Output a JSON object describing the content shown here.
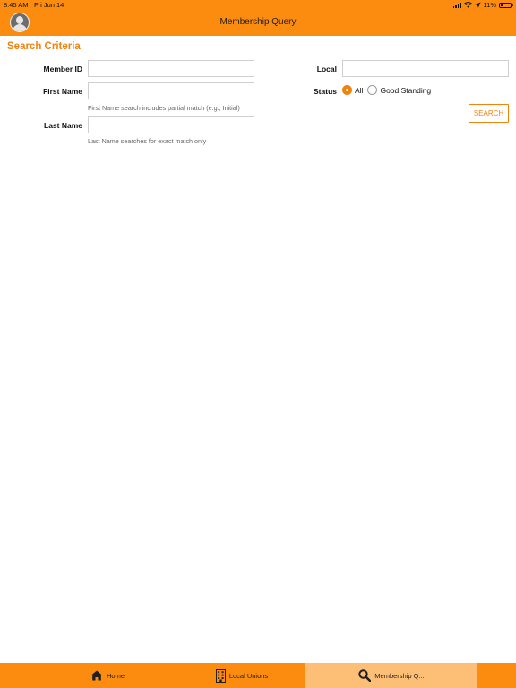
{
  "status_bar": {
    "time": "8:45 AM",
    "date": "Fri Jun 14",
    "battery": "11%"
  },
  "header": {
    "title": "Membership Query"
  },
  "search": {
    "section_title": "Search Criteria",
    "member_id_label": "Member ID",
    "member_id_value": "",
    "first_name_label": "First Name",
    "first_name_value": "",
    "first_name_hint": "First Name search includes partial match (e.g., Initial)",
    "last_name_label": "Last Name",
    "last_name_value": "",
    "last_name_hint": "Last Name searches for exact match only",
    "local_label": "Local",
    "local_value": "",
    "status_label": "Status",
    "status_options": [
      "All",
      "Good Standing"
    ],
    "status_selected": "All",
    "search_button": "SEARCH"
  },
  "tabs": [
    {
      "label": "Home",
      "icon": "home-icon",
      "active": false
    },
    {
      "label": "Local Unions",
      "icon": "building-icon",
      "active": false
    },
    {
      "label": "Membership Q...",
      "icon": "search-icon",
      "active": true
    }
  ],
  "colors": {
    "brand": "#fb8c0f",
    "accent_text": "#f0830d",
    "active_tab": "#fdbe76"
  }
}
